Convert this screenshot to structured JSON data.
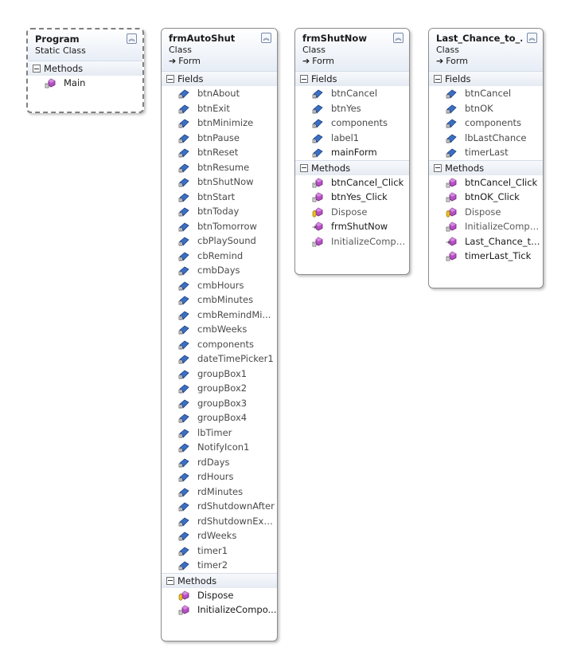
{
  "classes": {
    "program": {
      "title": "Program",
      "kind": "Static Class",
      "sections": {
        "methods": {
          "label": "Methods",
          "items": [
            "Main"
          ]
        }
      }
    },
    "frmAutoShut": {
      "title": "frmAutoShut",
      "kind": "Class",
      "base": "Form",
      "sections": {
        "fields": {
          "label": "Fields",
          "items": [
            "btnAbout",
            "btnExit",
            "btnMinimize",
            "btnPause",
            "btnReset",
            "btnResume",
            "btnShutNow",
            "btnStart",
            "btnToday",
            "btnTomorrow",
            "cbPlaySound",
            "cbRemind",
            "cmbDays",
            "cmbHours",
            "cmbMinutes",
            "cmbRemindMi...",
            "cmbWeeks",
            "components",
            "dateTimePicker1",
            "groupBox1",
            "groupBox2",
            "groupBox3",
            "groupBox4",
            "lbTimer",
            "NotifyIcon1",
            "rdDays",
            "rdHours",
            "rdMinutes",
            "rdShutdownAfter",
            "rdShutdownExa...",
            "rdWeeks",
            "timer1",
            "timer2"
          ]
        },
        "methods": {
          "label": "Methods",
          "items": [
            "Dispose",
            "InitializeCompo..."
          ]
        }
      }
    },
    "frmShutNow": {
      "title": "frmShutNow",
      "kind": "Class",
      "base": "Form",
      "sections": {
        "fields": {
          "label": "Fields",
          "items": [
            "btnCancel",
            "btnYes",
            "components",
            "label1",
            "mainForm"
          ]
        },
        "methods": {
          "label": "Methods",
          "items": [
            "btnCancel_Click",
            "btnYes_Click",
            "Dispose",
            "frmShutNow",
            "InitializeCompo..."
          ]
        }
      }
    },
    "lastChance": {
      "title": "Last_Chance_to_...",
      "kind": "Class",
      "base": "Form",
      "sections": {
        "fields": {
          "label": "Fields",
          "items": [
            "btnCancel",
            "btnOK",
            "components",
            "lbLastChance",
            "timerLast"
          ]
        },
        "methods": {
          "label": "Methods",
          "items": [
            "btnCancel_Click",
            "btnOK_Click",
            "Dispose",
            "InitializeCompo...",
            "Last_Chance_to...",
            "timerLast_Tick"
          ]
        }
      }
    }
  },
  "icons": {
    "field": "field-icon",
    "method": "method-icon",
    "protected-method": "protected-method-icon",
    "private-method": "private-method-icon",
    "constructor": "constructor-icon"
  },
  "colors": {
    "field_icon": "#3b6fc4",
    "method_icon": "#b64fc4",
    "protected_icon": "#e0a400"
  }
}
